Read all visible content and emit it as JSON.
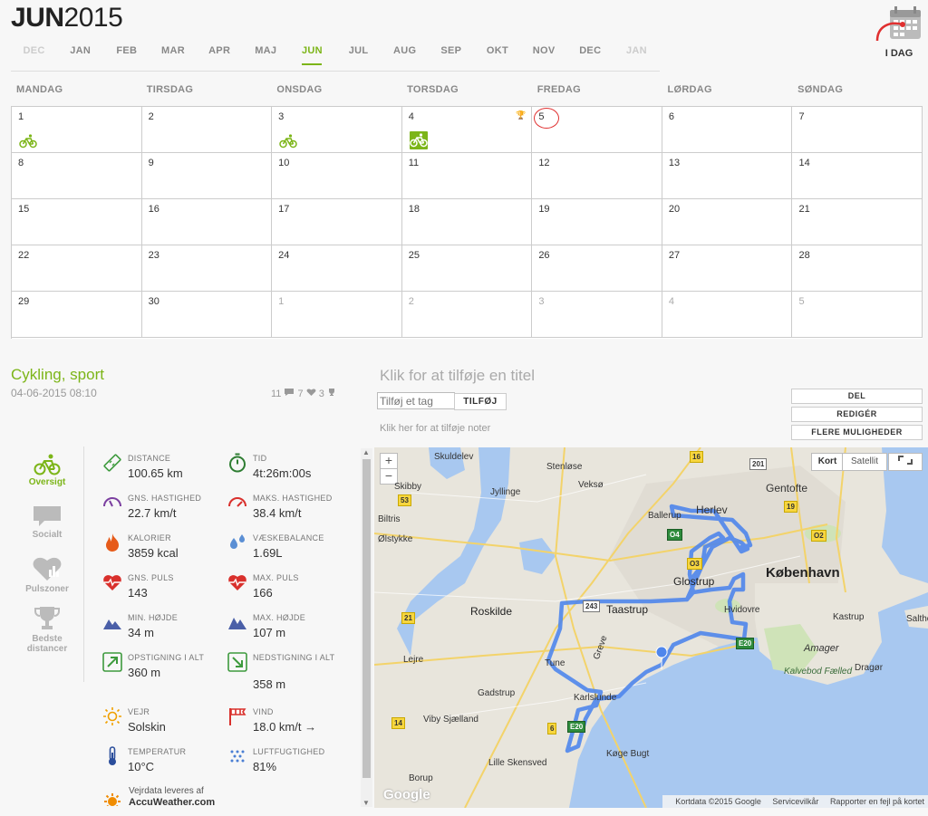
{
  "header": {
    "month": "JUN",
    "year": "2015",
    "today_label": "I DAG",
    "months": [
      {
        "label": "DEC",
        "state": "dim"
      },
      {
        "label": "JAN",
        "state": "normal"
      },
      {
        "label": "FEB",
        "state": "normal"
      },
      {
        "label": "MAR",
        "state": "normal"
      },
      {
        "label": "APR",
        "state": "normal"
      },
      {
        "label": "MAJ",
        "state": "normal"
      },
      {
        "label": "JUN",
        "state": "current"
      },
      {
        "label": "JUL",
        "state": "normal"
      },
      {
        "label": "AUG",
        "state": "normal"
      },
      {
        "label": "SEP",
        "state": "normal"
      },
      {
        "label": "OKT",
        "state": "normal"
      },
      {
        "label": "NOV",
        "state": "normal"
      },
      {
        "label": "DEC",
        "state": "normal"
      },
      {
        "label": "JAN",
        "state": "dim"
      }
    ]
  },
  "calendar": {
    "weekdays": [
      "MANDAG",
      "TIRSDAG",
      "ONSDAG",
      "TORSDAG",
      "FREDAG",
      "LØRDAG",
      "SØNDAG"
    ],
    "weeks": [
      [
        "1",
        "2",
        "3",
        "4",
        "5",
        "6",
        "7"
      ],
      [
        "8",
        "9",
        "10",
        "11",
        "12",
        "13",
        "14"
      ],
      [
        "15",
        "16",
        "17",
        "18",
        "19",
        "20",
        "21"
      ],
      [
        "22",
        "23",
        "24",
        "25",
        "26",
        "27",
        "28"
      ],
      [
        "29",
        "30",
        "1",
        "2",
        "3",
        "4",
        "5"
      ]
    ],
    "accent_color": "#7cb518"
  },
  "activity": {
    "title": "Cykling, sport",
    "datetime": "04-06-2015 08:10",
    "comments": "11",
    "likes": "7",
    "trophies": "3",
    "add_title": "Klik for at tilføje en titel",
    "tag_placeholder": "Tilføj et tag",
    "tag_button": "TILFØJ",
    "notes_placeholder": "Klik her for at tilføje noter",
    "actions": [
      "DEL",
      "REDIGÉR",
      "FLERE MULIGHEDER"
    ]
  },
  "nav": [
    {
      "label": "Oversigt",
      "icon": "bike-icon",
      "active": true
    },
    {
      "label": "Socialt",
      "icon": "speech-bubble-icon",
      "active": false
    },
    {
      "label": "Pulszoner",
      "icon": "heart-chart-icon",
      "active": false
    },
    {
      "label": "Bedste distancer",
      "icon": "trophy-icon",
      "active": false
    }
  ],
  "stats": [
    {
      "key": "DISTANCE",
      "value": "100.65 km",
      "icon": "distance-icon"
    },
    {
      "key": "TID",
      "value": "4t:26m:00s",
      "icon": "stopwatch-icon"
    },
    {
      "key": "GNS. HASTIGHED",
      "value": "22.7 km/t",
      "icon": "speedometer-icon"
    },
    {
      "key": "MAKS. HASTIGHED",
      "value": "38.4 km/t",
      "icon": "speedometer-max-icon"
    },
    {
      "key": "KALORIER",
      "value": "3859 kcal",
      "icon": "flame-icon"
    },
    {
      "key": "VÆSKEBALANCE",
      "value": "1.69L",
      "icon": "water-drops-icon"
    },
    {
      "key": "GNS. PULS",
      "value": "143",
      "icon": "heart-pulse-icon"
    },
    {
      "key": "MAX. PULS",
      "value": "166",
      "icon": "heart-pulse-max-icon"
    },
    {
      "key": "MIN. HØJDE",
      "value": "34 m",
      "icon": "mountain-icon"
    },
    {
      "key": "MAX. HØJDE",
      "value": "107 m",
      "icon": "mountain-max-icon"
    },
    {
      "key": "OPSTIGNING I ALT",
      "value": "360 m",
      "icon": "ascent-icon"
    },
    {
      "key": "NEDSTIGNING I ALT",
      "value": "358 m",
      "icon": "descent-icon"
    },
    {
      "key": "VEJR",
      "value": "Solskin",
      "icon": "sun-icon"
    },
    {
      "key": "VIND",
      "value": "18.0 km/t →",
      "icon": "windsock-icon"
    },
    {
      "key": "TEMPERATUR",
      "value": "10°C",
      "icon": "thermometer-icon"
    },
    {
      "key": "LUFTFUGTIGHED",
      "value": "81%",
      "icon": "humidity-icon"
    }
  ],
  "weather_credit": {
    "line1": "Vejrdata leveres af",
    "line2": "AccuWeather.com"
  },
  "map": {
    "type_buttons": [
      "Kort",
      "Satellit"
    ],
    "places": [
      "Skuldelev",
      "Stenløse",
      "Veksø",
      "Skibby",
      "Jyllinge",
      "Herlev",
      "Gentofte",
      "Ballerup",
      "Biltris",
      "Ølstykke",
      "Glostrup",
      "København",
      "Roskilde",
      "Taastrup",
      "Hvidovre",
      "Kastrup",
      "Amager",
      "Kalvebod Fælled",
      "Dragør",
      "Lejre",
      "Tune",
      "Greve",
      "Gadstrup",
      "Karlslunde",
      "Viby Sjælland",
      "Køge Bugt",
      "Lille Skensved",
      "Borup",
      "Saltholm"
    ],
    "roads": [
      "16",
      "201",
      "53",
      "19",
      "O4",
      "O2",
      "O3",
      "21",
      "243",
      "E20",
      "14",
      "6",
      "E20"
    ],
    "attribution": [
      "Kortdata ©2015 Google",
      "Servicevilkår",
      "Rapporter en fejl på kortet"
    ],
    "google": "Google"
  }
}
